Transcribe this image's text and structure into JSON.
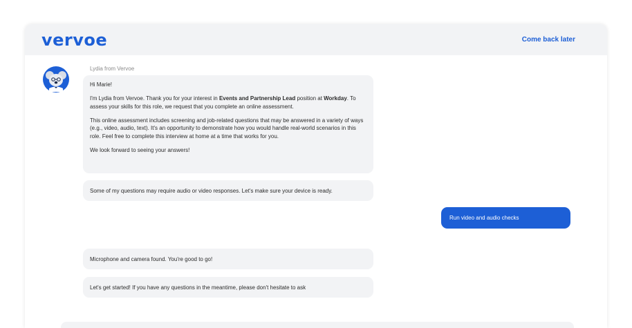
{
  "header": {
    "logo_text": "vervoe",
    "come_back_label": "Come back later"
  },
  "chat": {
    "sender_name": "Lydia from Vervoe",
    "intro_greeting": "Hi Marie!",
    "intro_p1_a": "I'm Lydia from Vervoe. Thank you for your interest in ",
    "intro_p1_role": "Events and Partnership Lead",
    "intro_p1_b": " position at ",
    "intro_p1_company": "Workday",
    "intro_p1_c": ". To assess your skills for this role, we request that you complete an online assessment.",
    "intro_p2": "This online assessment includes screening and job-related questions that may be answered in a variety of ways (e.g., video, audio, text). It's an opportunity to demonstrate how you would handle real-world scenarios in this role. Feel free to complete this interview at home at a time that works for you.",
    "intro_p3": "We look forward to seeing your answers!",
    "device_msg": "Some of my questions may require audio or video responses. Let's make sure your device is ready.",
    "user_action": "Run video and audio checks",
    "found_msg": "Microphone and camera found. You're good to go!",
    "start_msg": "Let's get started! If you have any questions in the meantime, please don't hesitate to ask"
  },
  "colors": {
    "brand": "#1d5fd6",
    "bubble_bg": "#f2f3f5"
  }
}
